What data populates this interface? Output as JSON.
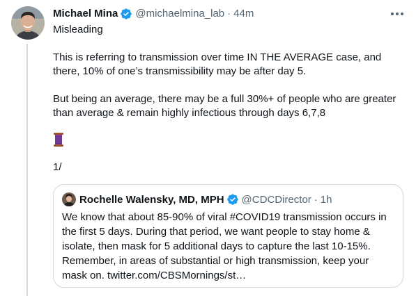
{
  "tweet": {
    "author_name": "Michael Mina",
    "handle": "@michaelmina_lab",
    "separator": "·",
    "time": "44m",
    "paragraphs": [
      "Misleading",
      "This is referring to transmission over time IN THE AVERAGE case, and there, 10% of one’s transmissibility may be after day 5.",
      "But being an average, there may be a full 30%+ of people who are greater than average & remain highly infectious through days 6,7,8",
      "1/"
    ],
    "emoji": "spool-of-thread-icon"
  },
  "quoted_tweet": {
    "author_name": "Rochelle Walensky, MD, MPH",
    "handle": "@CDCDirector",
    "separator": "·",
    "time": "1h",
    "text": "We know that about 85-90% of viral #COVID19 transmission occurs in the first 5 days. During that period, we want people to stay home & isolate, then mask for 5 additional days to capture the last 10-15%. Remember, in areas of substantial or high transmission, keep your mask on. twitter.com/CBSMornings/st…"
  },
  "colors": {
    "verified": "#1d9bf0",
    "text_primary": "#0f1419",
    "text_secondary": "#536471",
    "border": "#cfd9de"
  }
}
